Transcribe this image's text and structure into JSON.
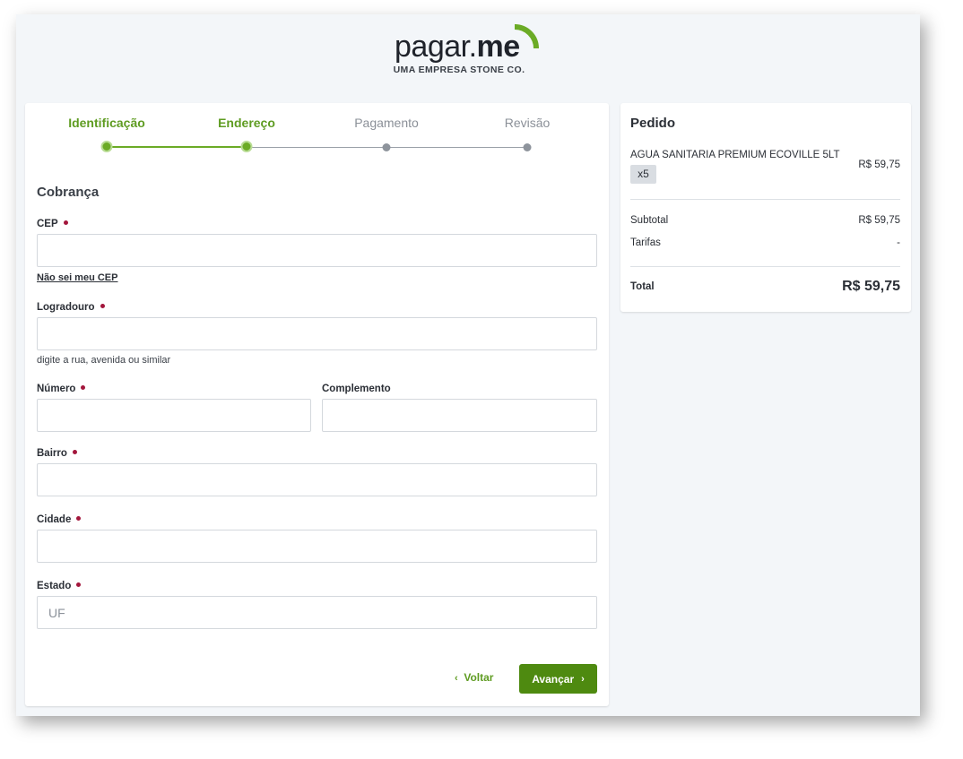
{
  "brand": {
    "logo_regular": "pagar.",
    "logo_bold": "me",
    "tagline": "UMA EMPRESA STONE CO.",
    "accent_color": "#6bab26"
  },
  "stepper": {
    "steps": [
      {
        "label": "Identificação",
        "state": "active"
      },
      {
        "label": "Endereço",
        "state": "active"
      },
      {
        "label": "Pagamento",
        "state": "inactive"
      },
      {
        "label": "Revisão",
        "state": "inactive"
      }
    ]
  },
  "form": {
    "section_title": "Cobrança",
    "cep": {
      "label": "CEP",
      "value": "",
      "placeholder": ""
    },
    "cep_link": "Não sei meu CEP",
    "logradouro": {
      "label": "Logradouro",
      "value": "",
      "placeholder": "",
      "help": "digite a rua, avenida ou similar"
    },
    "numero": {
      "label": "Número",
      "value": "",
      "placeholder": ""
    },
    "complemento": {
      "label": "Complemento",
      "value": "",
      "placeholder": ""
    },
    "bairro": {
      "label": "Bairro",
      "value": "",
      "placeholder": ""
    },
    "cidade": {
      "label": "Cidade",
      "value": "",
      "placeholder": ""
    },
    "estado": {
      "label": "Estado",
      "value": "",
      "placeholder": "UF"
    },
    "back_label": "Voltar",
    "next_label": "Avançar",
    "back_icon": "chevron-left-icon",
    "next_icon": "chevron-right-icon",
    "required_color": "#a3163c"
  },
  "order": {
    "title": "Pedido",
    "item": {
      "name": "AGUA SANITARIA PREMIUM ECOVILLE 5LT",
      "quantity": "x5",
      "price": "R$ 59,75"
    },
    "subtotal_label": "Subtotal",
    "subtotal_value": "R$ 59,75",
    "fees_label": "Tarifas",
    "fees_value": "-",
    "total_label": "Total",
    "total_value": "R$ 59,75"
  }
}
